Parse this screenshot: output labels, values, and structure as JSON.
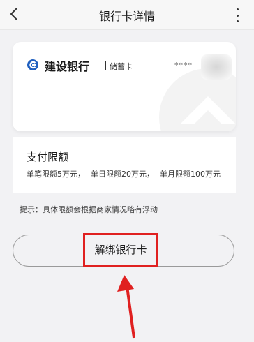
{
  "nav": {
    "title": "银行卡详情",
    "back_icon": "chevron-left-icon",
    "more_icon": "more-vertical-icon"
  },
  "card": {
    "bank_name": "建设银行",
    "card_type": "储蓄卡",
    "masked_number": "****",
    "logo_icon": "ccb-logo-icon",
    "logo_color": "#1f5fbf"
  },
  "limits": {
    "title": "支付限额",
    "single": "单笔限额5万元，",
    "daily": "单日限额20万元，",
    "monthly": "单月限额100万元"
  },
  "tip": "提示：具体限额会根据商家情况略有浮动",
  "actions": {
    "unbind_label": "解绑银行卡",
    "highlight_color": "#e02020"
  }
}
